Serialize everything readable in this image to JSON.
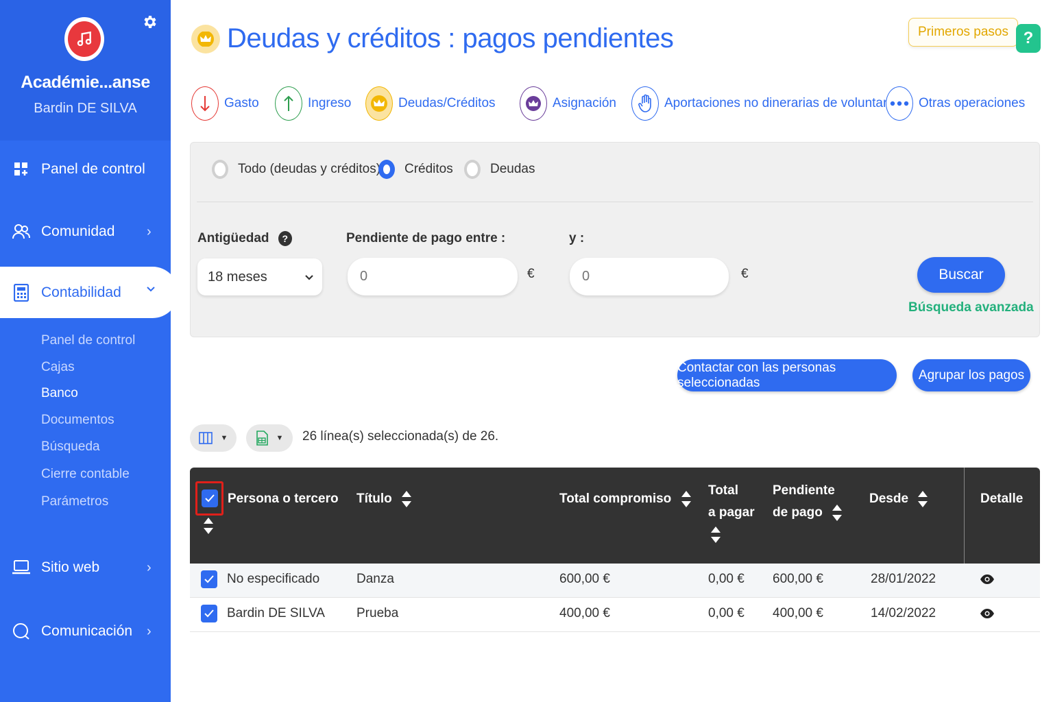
{
  "sidebar": {
    "org_name": "Académie...anse",
    "user_name": "Bardin DE SILVA",
    "nav": {
      "panel": "Panel de control",
      "comunidad": "Comunidad",
      "contabilidad": "Contabilidad",
      "sitio_web": "Sitio web",
      "comunicacion": "Comunicación"
    },
    "sub_items": [
      "Panel de control",
      "Cajas",
      "Banco",
      "Documentos",
      "Búsqueda",
      "Cierre contable",
      "Parámetros"
    ]
  },
  "header": {
    "title": "Deudas y créditos : pagos pendientes",
    "first_steps": "Primeros pasos",
    "help": "?"
  },
  "operations": [
    {
      "label": "Gasto",
      "icon": "arrow-down-icon",
      "color": "#e53935"
    },
    {
      "label": "Ingreso",
      "icon": "arrow-up-icon",
      "color": "#2e9e4f"
    },
    {
      "label": "Deudas/Créditos",
      "icon": "crown-icon",
      "color": "#f2b705"
    },
    {
      "label": "Asignación",
      "icon": "crown-swap-icon",
      "color": "#6a3d9a"
    },
    {
      "label": "Aportaciones no dinerarias de voluntarios",
      "icon": "hand-icon",
      "color": "#2f6bf0"
    },
    {
      "label": "Otras operaciones",
      "icon": "more-icon",
      "color": "#2f6bf0"
    }
  ],
  "filters": {
    "radios": [
      "Todo (deudas y créditos)",
      "Créditos",
      "Deudas"
    ],
    "selected_radio": "Créditos",
    "age_label": "Antigüedad",
    "age_value": "18 meses",
    "pending_label": "Pendiente de pago entre :",
    "and_label": "y :",
    "min_placeholder": "0",
    "max_placeholder": "0",
    "currency": "€",
    "search": "Buscar",
    "advanced": "Búsqueda avanzada"
  },
  "actions": {
    "contact": "Contactar con las personas seleccionadas",
    "group": "Agrupar los pagos"
  },
  "selection_text": "26 línea(s) seleccionada(s) de 26.",
  "table": {
    "columns": {
      "persona": "Persona o tercero",
      "titulo": "Título",
      "total_compromiso": "Total compromiso",
      "total_pagar_1": "Total",
      "total_pagar_2": "a pagar",
      "pendiente_1": "Pendiente",
      "pendiente_2": "de pago",
      "desde": "Desde",
      "detalle": "Detalle"
    },
    "rows": [
      {
        "persona": "No especificado",
        "titulo": "Danza",
        "total_compromiso": "600,00 €",
        "total_pagar": "0,00 €",
        "pendiente": "600,00 €",
        "desde": "28/01/2022"
      },
      {
        "persona": "Bardin DE SILVA",
        "titulo": "Prueba",
        "total_compromiso": "400,00 €",
        "total_pagar": "0,00 €",
        "pendiente": "400,00 €",
        "desde": "14/02/2022"
      }
    ]
  },
  "colors": {
    "primary": "#2f6bf0",
    "table_header": "#333333",
    "accent_green": "#23b07c",
    "accent_yellow": "#f2b705"
  }
}
